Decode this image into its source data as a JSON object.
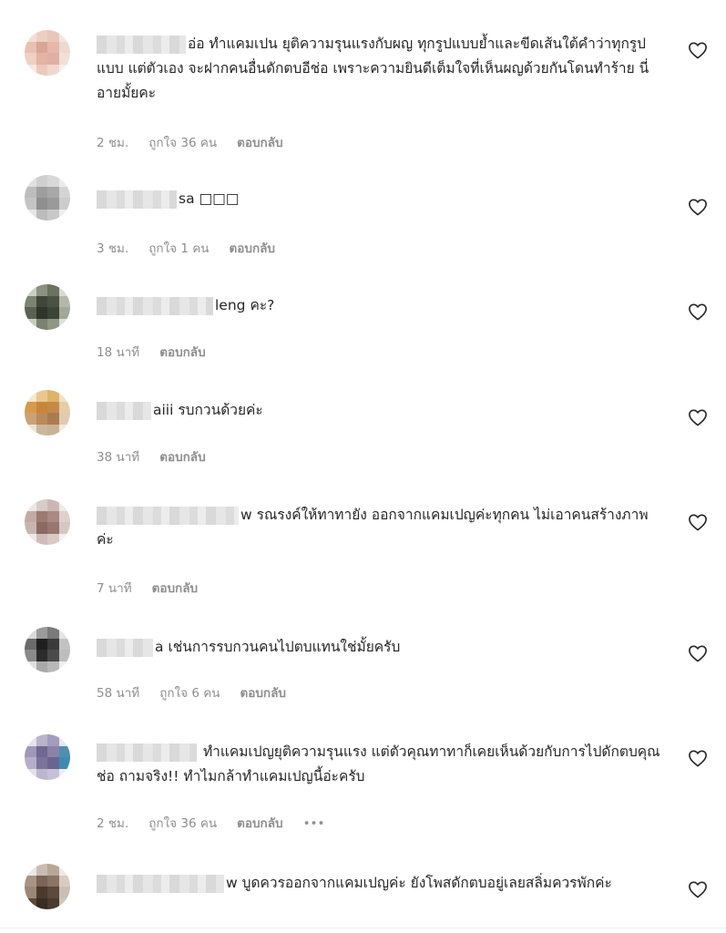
{
  "comments": [
    {
      "username_tail": "",
      "text": "อ่อ ทำแคมเปน ยุติความรุนแรงกับผญ ทุกรูปแบบย้ำและขีดเส้นใต้คำว่าทุกรูปแบบ แต่ตัวเอง จะฝากคนอื่นดักตบอีช่อ เพราะความยินดีเต็มใจที่เห็นผญด้วยกันโดนทำร้าย นี่อายมั้ยคะ",
      "time": "2 ชม.",
      "likes": "ถูกใจ 36 คน",
      "reply": "ตอบกลับ",
      "more": "",
      "avatar_colors": [
        "#f3ddd6",
        "#eccfc4",
        "#e9c6bb",
        "#f5e5df",
        "#e8c1b4",
        "#d9a596",
        "#e7b7a7",
        "#f0d8cf",
        "#efd0c4",
        "#e4b3a3",
        "#ddb1a3",
        "#f2dfd7",
        "#f6e8e3",
        "#ecc9bc",
        "#efd7cd",
        "#f8eeea"
      ]
    },
    {
      "username_tail": "sa",
      "text": "□□□",
      "time": "3 ชม.",
      "likes": "ถูกใจ 1 คน",
      "reply": "ตอบกลับ",
      "more": "",
      "avatar_colors": [
        "#e0e0e0",
        "#cfcfcf",
        "#d8d8d8",
        "#ebebeb",
        "#bdbdbd",
        "#9e9e9e",
        "#a8a8a8",
        "#d4d4d4",
        "#c4c4c4",
        "#8f8f8f",
        "#9a9a9a",
        "#cccccc",
        "#e6e6e6",
        "#bcbcbc",
        "#c8c8c8",
        "#eeeeee"
      ]
    },
    {
      "username_tail": "leng",
      "text": "คะ?",
      "time": "18 นาที",
      "likes": "",
      "reply": "ตอบกลับ",
      "more": "",
      "avatar_colors": [
        "#c9cec4",
        "#8b9282",
        "#6a7260",
        "#d7dbd2",
        "#7c8473",
        "#3f463a",
        "#4a5244",
        "#b3b9aa",
        "#5a6352",
        "#2f352b",
        "#3c4437",
        "#a1a898",
        "#c7ccc0",
        "#7a8270",
        "#8e9684",
        "#dfe2db"
      ]
    },
    {
      "username_tail": "aiii",
      "text": "รบกวนด้วยค่ะ",
      "time": "38 นาที",
      "likes": "",
      "reply": "ตอบกลับ",
      "more": "",
      "avatar_colors": [
        "#f4e6cf",
        "#e9c78f",
        "#dfb26a",
        "#efe0c8",
        "#d79a4c",
        "#c9863b",
        "#c58a48",
        "#e5cda6",
        "#caa276",
        "#b98a5c",
        "#a97c54",
        "#dfcbb0",
        "#ece2d3",
        "#cdb79a",
        "#c9b295",
        "#f1e9dd"
      ]
    },
    {
      "username_tail": "w",
      "text": "รณรงค์ให้ทาทายัง ออกจากแคมเปญค่ะทุกคน ไม่เอาคนสร้างภาพค่ะ",
      "time": "7 นาที",
      "likes": "",
      "reply": "ตอบกลับ",
      "more": "",
      "avatar_colors": [
        "#ece6e5",
        "#d8cbc8",
        "#cbb8b4",
        "#efe9e8",
        "#c4aaa5",
        "#9c7a72",
        "#a88a83",
        "#ddd0cd",
        "#c9b5b0",
        "#8a6a63",
        "#97776f",
        "#d6c7c3",
        "#efe9e8",
        "#cfbdb9",
        "#d9cac7",
        "#f4f0ef"
      ]
    },
    {
      "username_tail": "a",
      "text": "เช่นการรบกวนคนไปตบแทนใช่มั้ยครับ",
      "time": "58 นาที",
      "likes": "ถูกใจ 6 คน",
      "reply": "ตอบกลับ",
      "more": "",
      "avatar_colors": [
        "#d9d9d9",
        "#9a9a9a",
        "#7a7a7a",
        "#e3e3e3",
        "#6b6b6b",
        "#1f1f1f",
        "#3a3a3a",
        "#c2c2c2",
        "#8a8a8a",
        "#2b2b2b",
        "#4a4a4a",
        "#bdbdbd",
        "#e0e0e0",
        "#a9a9a9",
        "#b8b8b8",
        "#eeeeee"
      ]
    },
    {
      "username_tail": "",
      "text": "ทำแคมเปญยุติความรุนแรง แต่ตัวคุณทาทาก็เคยเห็นด้วยกับการไปดักตบคุณช่อ ถามจริง!! ทำไมกล้าทำแคมเปญนี้อ่ะครับ",
      "time": "2 ชม.",
      "likes": "ถูกใจ 36 คน",
      "reply": "ตอบกลับ",
      "more": "•••",
      "avatar_colors": [
        "#e4e2ec",
        "#b9b3cc",
        "#a49cbd",
        "#e8e6ef",
        "#9f98b8",
        "#6f6892",
        "#8a83a8",
        "#4f8fae",
        "#b5aec8",
        "#7b7399",
        "#6a6490",
        "#3f8bb0",
        "#e2e0ea",
        "#bcb7cc",
        "#c6c1d4",
        "#eeedf3"
      ]
    },
    {
      "username_tail": "w",
      "text": "บูดควรออกจากแคมเปญค่ะ ยังโพสดักตบอยู่เลยสลิ่มควรพักค่ะ",
      "time": "",
      "likes": "",
      "reply": "",
      "more": "",
      "avatar_colors": [
        "#ece7e3",
        "#c9bcb2",
        "#b8a797",
        "#eeeae6",
        "#a89484",
        "#7a6454",
        "#8a7464",
        "#d8ccc2",
        "#9c8674",
        "#4a3a2e",
        "#5c4a3c",
        "#cbbfb5",
        "#5a4a3e",
        "#3a2c22",
        "#4a3a30",
        "#d2c6bc"
      ]
    }
  ]
}
